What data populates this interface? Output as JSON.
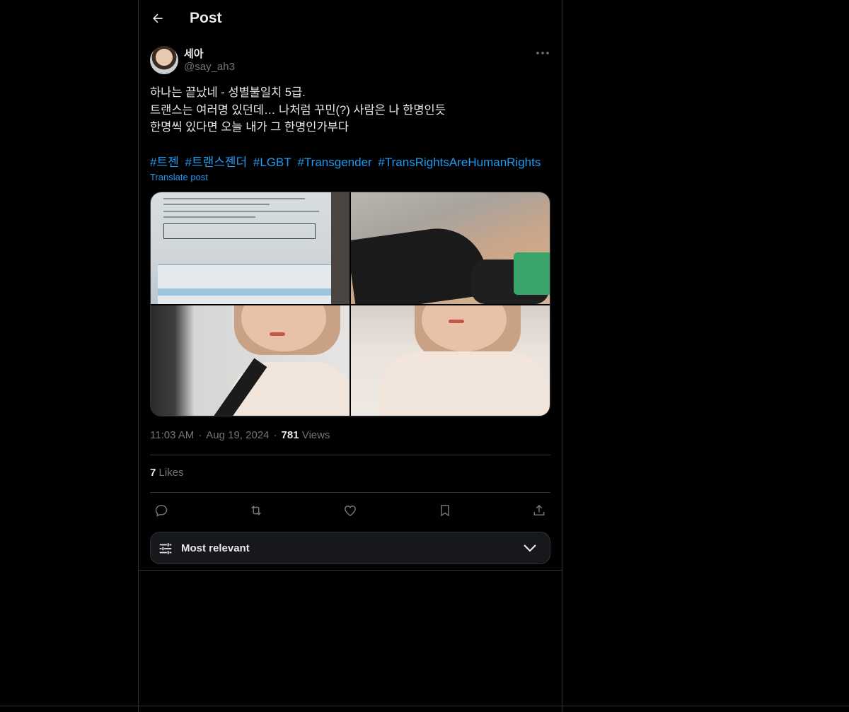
{
  "header": {
    "title": "Post",
    "back_icon": "arrow-left-icon"
  },
  "author": {
    "display_name": "세아",
    "handle": "@say_ah3"
  },
  "tweet": {
    "lines": [
      "하나는 끝났네 - 성별불일치 5급.",
      "트랜스는 여러명 있던데… 나처럼 꾸민(?) 사람은 나 한명인듯",
      "한명씩 있다면 오늘 내가 그 한명인가부다"
    ],
    "hashtags": [
      "#트젠",
      "#트랜스젠더",
      "#LGBT",
      "#Transgender",
      "#TransRightsAreHumanRights"
    ],
    "translate_label": "Translate post"
  },
  "meta": {
    "time": "11:03 AM",
    "date": "Aug 19, 2024",
    "views_count": "781",
    "views_label": "Views"
  },
  "likes": {
    "count": "7",
    "label": "Likes"
  },
  "actions": [
    "reply-icon",
    "retweet-icon",
    "like-icon",
    "bookmark-icon",
    "share-icon"
  ],
  "sort": {
    "label": "Most relevant",
    "icon": "sliders-icon",
    "chevron": "chevron-down-icon"
  },
  "colors": {
    "accent": "#1d9bf0",
    "background": "#000000",
    "muted": "#71767b",
    "border": "#2f3336"
  }
}
